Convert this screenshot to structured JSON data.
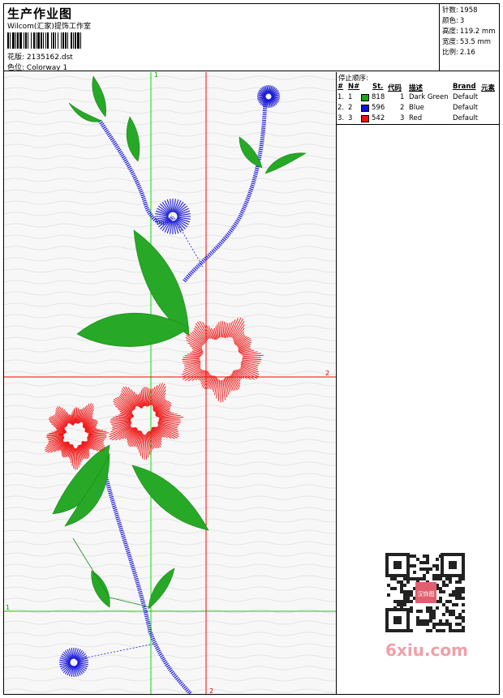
{
  "header": {
    "title": "生产作业图",
    "subtitle": "Wilcom(汇家)提饰工作室",
    "design_label": "花版:",
    "design_file": "2135162.dst",
    "colorway_label": "色位:",
    "colorway_value": "Colorway 1"
  },
  "stats": {
    "stitches_label": "针数:",
    "stitches_value": "1958",
    "colors_label": "颜色:",
    "colors_value": "3",
    "height_label": "高度:",
    "height_value": "119.2 mm",
    "width_label": "宽度:",
    "width_value": "53.5 mm",
    "scale_label": "比例:",
    "scale_value": "2.16"
  },
  "canvas": {
    "axis_labels": {
      "green_top": "1",
      "green_left": "1",
      "red_right": "2",
      "red_bottom": "2"
    },
    "colors": {
      "green": "#1fa51f",
      "blue": "#1c1cd8",
      "red": "#f01010",
      "guide_green": "#00dd00",
      "guide_red": "#ff0000"
    }
  },
  "stop_sequence": {
    "title": "停止顺序:",
    "headers": [
      "#",
      "N#",
      "St.",
      "代码",
      "描述",
      "Brand",
      "元素"
    ],
    "rows": [
      {
        "idx": "1.",
        "n": "1",
        "color": "#1aa51a",
        "stitches": "818",
        "code": "1",
        "desc": "Dark Green",
        "brand": "Default"
      },
      {
        "idx": "2.",
        "n": "2",
        "color": "#1010e0",
        "stitches": "596",
        "code": "2",
        "desc": "Blue",
        "brand": "Default"
      },
      {
        "idx": "3.",
        "n": "3",
        "color": "#f01010",
        "stitches": "542",
        "code": "3",
        "desc": "Red",
        "brand": "Default"
      }
    ]
  },
  "watermark": {
    "text": "6xiu.com",
    "badge": "汉饰图"
  }
}
